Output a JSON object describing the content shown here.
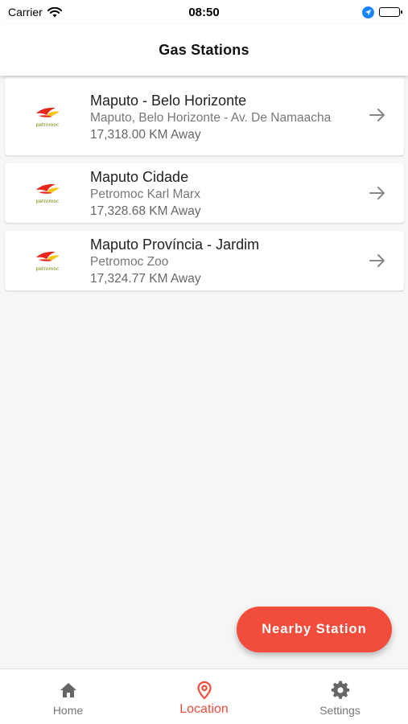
{
  "status_bar": {
    "carrier": "Carrier",
    "time": "08:50"
  },
  "header": {
    "title": "Gas Stations"
  },
  "stations": [
    {
      "name": "Maputo - Belo Horizonte",
      "address": "Maputo, Belo Horizonte - Av. De Namaacha",
      "distance": "17,318.00 KM Away",
      "logo_text": "petromoc"
    },
    {
      "name": "Maputo Cidade",
      "address": "Petromoc Karl Marx",
      "distance": "17,328.68 KM Away",
      "logo_text": "petromoc"
    },
    {
      "name": "Maputo Província - Jardim",
      "address": "Petromoc Zoo",
      "distance": "17,324.77 KM Away",
      "logo_text": "petromoc"
    }
  ],
  "fab": {
    "label": "Nearby Station"
  },
  "bottom_nav": {
    "items": [
      {
        "label": "Home",
        "icon": "home-icon",
        "active": false
      },
      {
        "label": "Location",
        "icon": "location-pin-icon",
        "active": true
      },
      {
        "label": "Settings",
        "icon": "gear-icon",
        "active": false
      }
    ]
  },
  "colors": {
    "accent": "#f14c3c",
    "background": "#f6f6f6",
    "card": "#ffffff",
    "logo_red": "#e8271c",
    "logo_yellow": "#f6c416"
  }
}
